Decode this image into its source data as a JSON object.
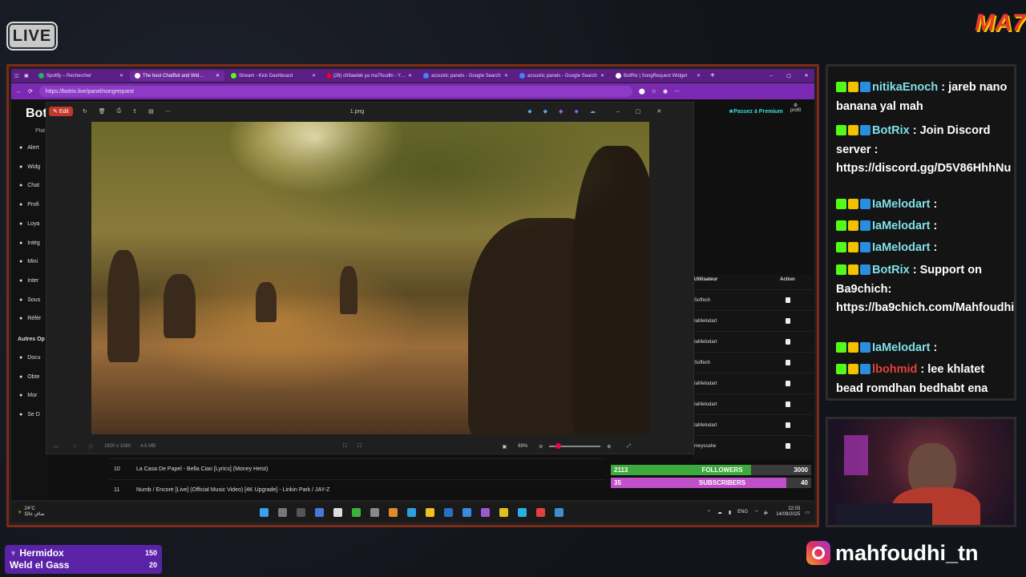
{
  "overlay": {
    "live_label": "LIVE",
    "logo_text": "MA7",
    "instagram_handle": "mahfoudhi_tn"
  },
  "browser": {
    "tabs": [
      {
        "label": "Spotify – Rechercher",
        "icon": "spotify-icon",
        "color": "#1db954"
      },
      {
        "label": "The best ChatBot and Wid…",
        "icon": "botrix-icon",
        "color": "#ffffff",
        "active": true
      },
      {
        "label": "Stream - Kick Dashboard",
        "icon": "kick-icon",
        "color": "#53fc18"
      },
      {
        "label": "(28) ch9awlek ya ma7foudhi - Y…",
        "icon": "youtube-icon",
        "color": "#ff0000"
      },
      {
        "label": "acoustic panels - Google Search",
        "icon": "google-icon",
        "color": "#4285f4"
      },
      {
        "label": "acoustic panels - Google Search",
        "icon": "google-icon",
        "color": "#4285f4"
      },
      {
        "label": "BotRix | SongRequest Widget",
        "icon": "botrix-icon",
        "color": "#ffffff"
      }
    ],
    "url": "https://botrix.live/panel/songrequest"
  },
  "botrix": {
    "brand": "Bot",
    "premium_label": "Passez à Premium",
    "profile_label": "profil",
    "sidebar_heading": "Plat",
    "sidebar_items": [
      "Alert",
      "Widg",
      "Chat",
      "Profi",
      "Loya",
      "Intég",
      "Mini",
      "Inter",
      "Sous",
      "Référ"
    ],
    "other_heading": "Autres Op",
    "other_items": [
      "Docu",
      "Obte",
      "Mor",
      "Se D"
    ],
    "table": {
      "col_user": "Utilisateur",
      "col_action": "Action",
      "rows": [
        "Soffech",
        "IaMelodart",
        "IaMelodart",
        "Soffech",
        "IaMelodart",
        "IaMelodart",
        "IaMelodart",
        "meyssahe"
      ]
    },
    "songs": [
      {
        "num": "10",
        "title": "La Casa De Papel - Bella Ciao [Lyrics] (Money Heist)"
      },
      {
        "num": "11",
        "title": "Numb / Encore [Live] (Official Music Video) [4K Upgrade] - Linkin Park / JAY-Z"
      }
    ]
  },
  "viewer": {
    "edit_label": "Edit",
    "filename": "1.png",
    "dimensions": "1920 x 1080",
    "filesize": "4.5 MB",
    "zoom": "69%"
  },
  "goals": {
    "followers": {
      "current": "2113",
      "label": "FOLLOWERS",
      "target": "3000",
      "progress": 0.7,
      "color": "#3daa3d"
    },
    "subscribers": {
      "current": "35",
      "label": "SUBSCRIBERS",
      "target": "40",
      "progress": 0.875,
      "color": "#c050c8"
    }
  },
  "taskbar": {
    "weather_temp": "24°C",
    "weather_desc": "صافٍ غالبًا",
    "lang": "ENG",
    "time": "22:03",
    "date": "14/09/2025"
  },
  "chat": [
    {
      "user": "nitikaEnoch",
      "user_color": "#7fe0e8",
      "text": " : jareb nano banana yal mah"
    },
    {
      "user": "BotRix",
      "user_color": "#7fe0e8",
      "text": " : Join Discord server : https://discord.gg/D5V86HhhNu"
    },
    {
      "user": "IaMelodart",
      "user_color": "#7fe0e8",
      "text": " :"
    },
    {
      "user": "IaMelodart",
      "user_color": "#7fe0e8",
      "text": " :"
    },
    {
      "user": "IaMelodart",
      "user_color": "#7fe0e8",
      "text": " :"
    },
    {
      "user": "BotRix",
      "user_color": "#7fe0e8",
      "text": " : Support on Ba9chich: https://ba9chich.com/Mahfoudhi"
    },
    {
      "user": "IaMelodart",
      "user_color": "#7fe0e8",
      "text": " :"
    },
    {
      "user": "lbohmid",
      "user_color": "#e0413a",
      "text": " : lee khlatet bead romdhan bedhabt ena"
    }
  ],
  "bottom_left": [
    {
      "name": "Hermidox",
      "value": "150"
    },
    {
      "name": "Weld el Gass",
      "value": "20"
    }
  ]
}
